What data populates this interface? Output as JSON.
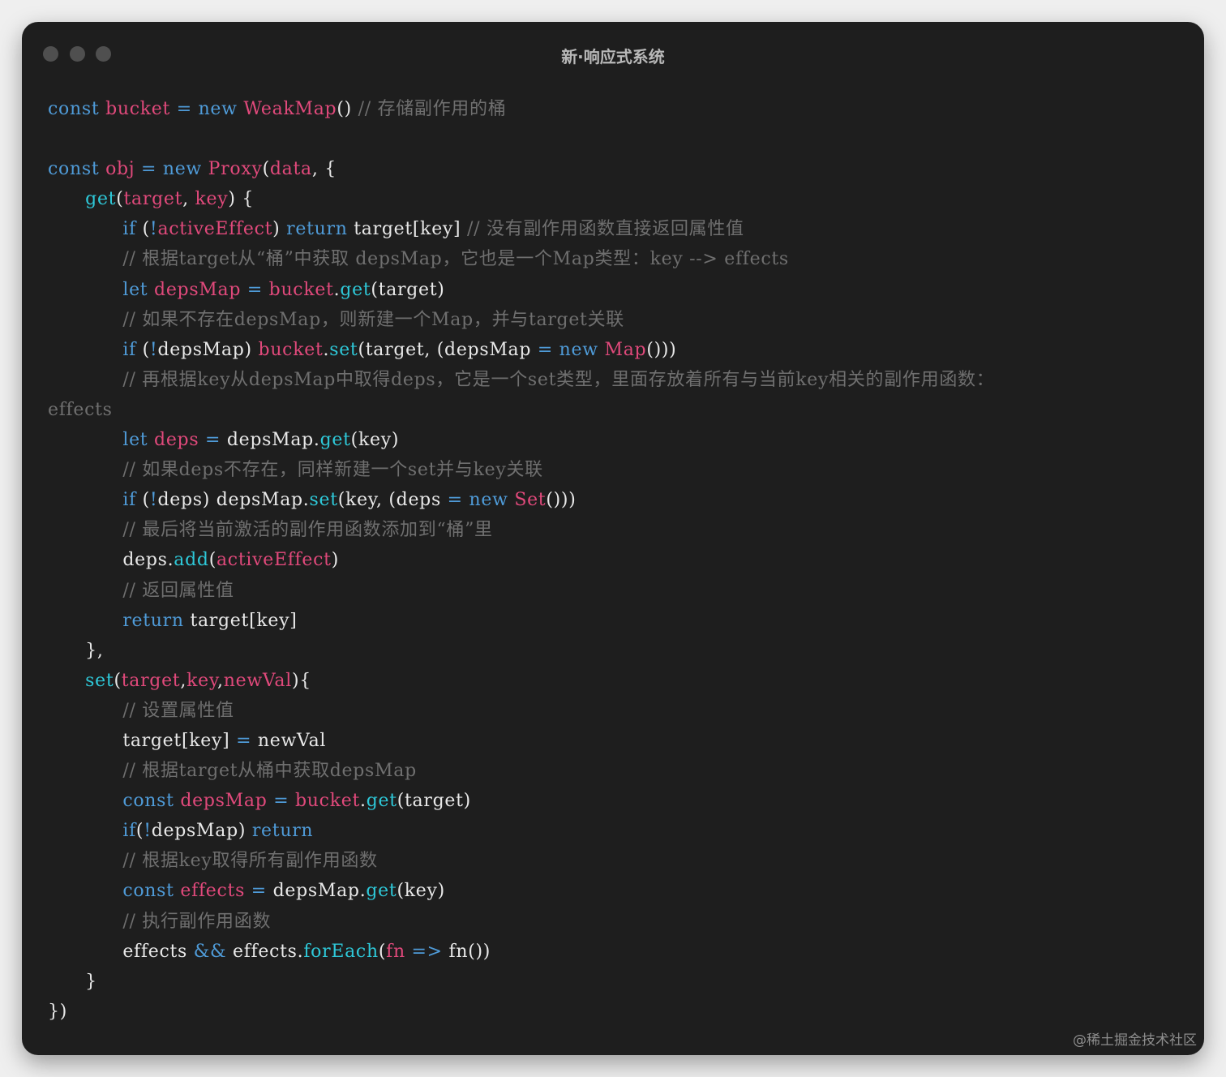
{
  "window": {
    "title": "新·响应式系统",
    "watermark": "@稀土掘金技术社区"
  },
  "code_lines": [
    [
      [
        "const ",
        "kw"
      ],
      [
        "bucket ",
        "nm"
      ],
      [
        "= ",
        "op"
      ],
      [
        "new ",
        "kw"
      ],
      [
        "WeakMap",
        "nm"
      ],
      [
        "() ",
        "pl"
      ],
      [
        "// 存储副作用的桶",
        "cm"
      ]
    ],
    [],
    [
      [
        "const ",
        "kw"
      ],
      [
        "obj ",
        "nm"
      ],
      [
        "= ",
        "op"
      ],
      [
        "new ",
        "kw"
      ],
      [
        "Proxy",
        "nm"
      ],
      [
        "(",
        "pl"
      ],
      [
        "data",
        "nm"
      ],
      [
        ", {",
        "pl"
      ]
    ],
    [
      [
        "      ",
        "pl"
      ],
      [
        "get",
        "fn"
      ],
      [
        "(",
        "pl"
      ],
      [
        "target",
        "nm"
      ],
      [
        ", ",
        "pl"
      ],
      [
        "key",
        "nm"
      ],
      [
        ") {",
        "pl"
      ]
    ],
    [
      [
        "            ",
        "pl"
      ],
      [
        "if ",
        "kw"
      ],
      [
        "(",
        "pl"
      ],
      [
        "!",
        "op"
      ],
      [
        "activeEffect",
        "nm"
      ],
      [
        ") ",
        "pl"
      ],
      [
        "return ",
        "kw"
      ],
      [
        "target[key] ",
        "pl"
      ],
      [
        "// 没有副作用函数直接返回属性值",
        "cm"
      ]
    ],
    [
      [
        "            ",
        "pl"
      ],
      [
        "// 根据target从“桶”中获取 depsMap，它也是一个Map类型：key --> effects",
        "cm"
      ]
    ],
    [
      [
        "            ",
        "pl"
      ],
      [
        "let ",
        "kw"
      ],
      [
        "depsMap ",
        "nm"
      ],
      [
        "= ",
        "op"
      ],
      [
        "bucket",
        "nm"
      ],
      [
        ".",
        "pl"
      ],
      [
        "get",
        "fn"
      ],
      [
        "(target)",
        "pl"
      ]
    ],
    [
      [
        "            ",
        "pl"
      ],
      [
        "// 如果不存在depsMap，则新建一个Map，并与target关联",
        "cm"
      ]
    ],
    [
      [
        "            ",
        "pl"
      ],
      [
        "if ",
        "kw"
      ],
      [
        "(",
        "pl"
      ],
      [
        "!",
        "op"
      ],
      [
        "depsMap) ",
        "pl"
      ],
      [
        "bucket",
        "nm"
      ],
      [
        ".",
        "pl"
      ],
      [
        "set",
        "fn"
      ],
      [
        "(target, (depsMap ",
        "pl"
      ],
      [
        "= ",
        "op"
      ],
      [
        "new ",
        "kw"
      ],
      [
        "Map",
        "nm"
      ],
      [
        "()))",
        "pl"
      ]
    ],
    [
      [
        "            ",
        "pl"
      ],
      [
        "// 再根据key从depsMap中取得deps，它是一个set类型，里面存放着所有与当前key相关的副作用函数：",
        "cm"
      ]
    ],
    [
      [
        "effects",
        "cm"
      ]
    ],
    [
      [
        "            ",
        "pl"
      ],
      [
        "let ",
        "kw"
      ],
      [
        "deps ",
        "nm"
      ],
      [
        "= ",
        "op"
      ],
      [
        "depsMap.",
        "pl"
      ],
      [
        "get",
        "fn"
      ],
      [
        "(key)",
        "pl"
      ]
    ],
    [
      [
        "            ",
        "pl"
      ],
      [
        "// 如果deps不存在，同样新建一个set并与key关联",
        "cm"
      ]
    ],
    [
      [
        "            ",
        "pl"
      ],
      [
        "if ",
        "kw"
      ],
      [
        "(",
        "pl"
      ],
      [
        "!",
        "op"
      ],
      [
        "deps) depsMap.",
        "pl"
      ],
      [
        "set",
        "fn"
      ],
      [
        "(key, (deps ",
        "pl"
      ],
      [
        "= ",
        "op"
      ],
      [
        "new ",
        "kw"
      ],
      [
        "Set",
        "nm"
      ],
      [
        "()))",
        "pl"
      ]
    ],
    [
      [
        "            ",
        "pl"
      ],
      [
        "// 最后将当前激活的副作用函数添加到“桶”里",
        "cm"
      ]
    ],
    [
      [
        "            ",
        "pl"
      ],
      [
        "deps.",
        "pl"
      ],
      [
        "add",
        "fn"
      ],
      [
        "(",
        "pl"
      ],
      [
        "activeEffect",
        "nm"
      ],
      [
        ")",
        "pl"
      ]
    ],
    [
      [
        "            ",
        "pl"
      ],
      [
        "// 返回属性值",
        "cm"
      ]
    ],
    [
      [
        "            ",
        "pl"
      ],
      [
        "return ",
        "kw"
      ],
      [
        "target[key]",
        "pl"
      ]
    ],
    [
      [
        "      ",
        "pl"
      ],
      [
        "},",
        "pl"
      ]
    ],
    [
      [
        "      ",
        "pl"
      ],
      [
        "set",
        "fn"
      ],
      [
        "(",
        "pl"
      ],
      [
        "target",
        "nm"
      ],
      [
        ",",
        "pl"
      ],
      [
        "key",
        "nm"
      ],
      [
        ",",
        "pl"
      ],
      [
        "newVal",
        "nm"
      ],
      [
        "){",
        "pl"
      ]
    ],
    [
      [
        "            ",
        "pl"
      ],
      [
        "// 设置属性值",
        "cm"
      ]
    ],
    [
      [
        "            ",
        "pl"
      ],
      [
        "target[key] ",
        "pl"
      ],
      [
        "= ",
        "op"
      ],
      [
        "newVal",
        "pl"
      ]
    ],
    [
      [
        "            ",
        "pl"
      ],
      [
        "// 根据target从桶中获取depsMap",
        "cm"
      ]
    ],
    [
      [
        "            ",
        "pl"
      ],
      [
        "const ",
        "kw"
      ],
      [
        "depsMap ",
        "nm"
      ],
      [
        "= ",
        "op"
      ],
      [
        "bucket",
        "nm"
      ],
      [
        ".",
        "pl"
      ],
      [
        "get",
        "fn"
      ],
      [
        "(target)",
        "pl"
      ]
    ],
    [
      [
        "            ",
        "pl"
      ],
      [
        "if",
        "kw"
      ],
      [
        "(",
        "pl"
      ],
      [
        "!",
        "op"
      ],
      [
        "depsMap) ",
        "pl"
      ],
      [
        "return",
        "kw"
      ]
    ],
    [
      [
        "            ",
        "pl"
      ],
      [
        "// 根据key取得所有副作用函数",
        "cm"
      ]
    ],
    [
      [
        "            ",
        "pl"
      ],
      [
        "const ",
        "kw"
      ],
      [
        "effects ",
        "nm"
      ],
      [
        "= ",
        "op"
      ],
      [
        "depsMap.",
        "pl"
      ],
      [
        "get",
        "fn"
      ],
      [
        "(key)",
        "pl"
      ]
    ],
    [
      [
        "            ",
        "pl"
      ],
      [
        "// 执行副作用函数",
        "cm"
      ]
    ],
    [
      [
        "            ",
        "pl"
      ],
      [
        "effects ",
        "pl"
      ],
      [
        "&& ",
        "op"
      ],
      [
        "effects.",
        "pl"
      ],
      [
        "forEach",
        "fn"
      ],
      [
        "(",
        "pl"
      ],
      [
        "fn ",
        "nm"
      ],
      [
        "=> ",
        "op"
      ],
      [
        "fn())",
        "pl"
      ]
    ],
    [
      [
        "      ",
        "pl"
      ],
      [
        "}",
        "pl"
      ]
    ],
    [
      [
        "})",
        "pl"
      ]
    ]
  ],
  "colors": {
    "window_bg": "#1e1e1e",
    "keyword": "#4f9bd8",
    "identifier": "#e0497b",
    "function": "#2ec8d8",
    "plain": "#e8e8e8",
    "comment": "#6f6f6f"
  }
}
